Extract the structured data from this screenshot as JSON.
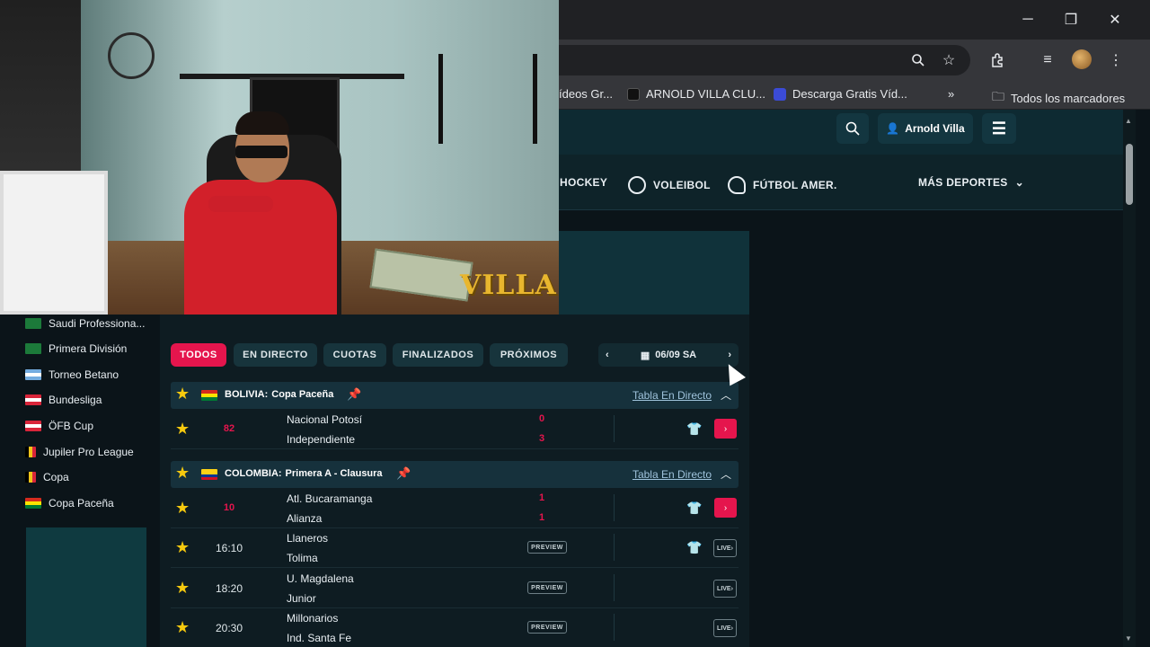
{
  "browser": {
    "bookmarks": [
      {
        "label": "ídeos Gr..."
      },
      {
        "label": "ARNOLD VILLA CLU..."
      },
      {
        "label": "Descarga Gratis Víd..."
      },
      {
        "label": "Todos los marcadores"
      }
    ]
  },
  "site": {
    "user_name": "Arnold Villa",
    "sports": [
      {
        "label": "HOCKEY"
      },
      {
        "label": "VOLEIBOL"
      },
      {
        "label": "FÚTBOL AMER."
      }
    ],
    "more_sports": "MÁS DEPORTES"
  },
  "webcam": {
    "logo_text": "VILLA"
  },
  "sidebar": {
    "leagues": [
      {
        "label": "Saudi Professiona...",
        "flag": "#1c7a3a"
      },
      {
        "label": "Primera División",
        "flag": "#1c7a3a"
      },
      {
        "label": "Torneo Betano",
        "flag": "#74acdf"
      },
      {
        "label": "Bundesliga",
        "flag": "#d9253a"
      },
      {
        "label": "ÖFB Cup",
        "flag": "#d9253a"
      },
      {
        "label": "Jupiler Pro League",
        "flag": "#f0c419"
      },
      {
        "label": "Copa",
        "flag": "#f0c419"
      },
      {
        "label": "Copa Paceña",
        "flag": "#d52b1e"
      }
    ]
  },
  "filters": {
    "tabs": [
      {
        "label": "TODOS",
        "active": true
      },
      {
        "label": "EN DIRECTO",
        "active": false
      },
      {
        "label": "CUOTAS",
        "active": false
      },
      {
        "label": "FINALIZADOS",
        "active": false
      },
      {
        "label": "PRÓXIMOS",
        "active": false
      }
    ],
    "date": "06/09 SA"
  },
  "groups": [
    {
      "country": "BOLIVIA:",
      "league": "Copa Paceña",
      "tabla": "Tabla En Directo",
      "matches": [
        {
          "time": "82",
          "live": true,
          "home": "Nacional Potosí",
          "away": "Independiente",
          "home_score": "0",
          "away_score": "3"
        }
      ]
    },
    {
      "country": "COLOMBIA:",
      "league": "Primera A - Clausura",
      "tabla": "Tabla En Directo",
      "matches": [
        {
          "time": "10",
          "live": true,
          "home": "Atl. Bucaramanga",
          "away": "Alianza",
          "home_score": "1",
          "away_score": "1"
        },
        {
          "time": "16:10",
          "live": false,
          "home": "Llaneros",
          "away": "Tolima",
          "preview": "PREVIEW",
          "live_label": "LIVE"
        },
        {
          "time": "18:20",
          "live": false,
          "home": "U. Magdalena",
          "away": "Junior",
          "preview": "PREVIEW",
          "live_label": "LIVE"
        },
        {
          "time": "20:30",
          "live": false,
          "home": "Millonarios",
          "away": "Ind. Santa Fe",
          "preview": "PREVIEW",
          "live_label": "LIVE"
        }
      ]
    }
  ],
  "colors": {
    "accent": "#e5154d",
    "star": "#f6c90e",
    "panel": "#0e1c22"
  }
}
